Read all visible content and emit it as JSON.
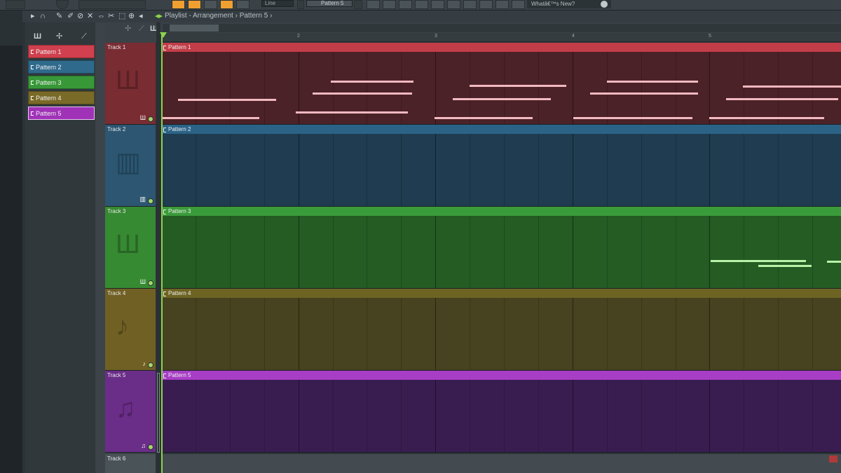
{
  "toolbar": {
    "snap_value": "Line",
    "pattern_selector": "Pattern 5",
    "whats_new": "Whatâ€™s New?"
  },
  "playlist": {
    "breadcrumb": "Playlist - Arrangement › Pattern 5 ›",
    "ruler": [
      "2",
      "3",
      "4",
      "5"
    ]
  },
  "picker": {
    "patterns": [
      {
        "label": "Pattern 1",
        "color": "#d0404e"
      },
      {
        "label": "Pattern 2",
        "color": "#2f6a8c"
      },
      {
        "label": "Pattern 3",
        "color": "#389838"
      },
      {
        "label": "Pattern 4",
        "color": "#7a6a28"
      },
      {
        "label": "Pattern 5",
        "color": "#a032b8"
      }
    ]
  },
  "tracks": [
    {
      "label": "Track 1",
      "clip": "Pattern 1",
      "header_color": "#7a2c33",
      "lane_color": "#4b2228",
      "clip_color": "#c33d48",
      "note_color": "#f3b9c0",
      "icon": "piano-roll-icon"
    },
    {
      "label": "Track 2",
      "clip": "Pattern 2",
      "header_color": "#2c5672",
      "lane_color": "#1f3c50",
      "clip_color": "#2b6387",
      "note_color": "#9cd0ef",
      "icon": "drum-icon"
    },
    {
      "label": "Track 3",
      "clip": "Pattern 3",
      "header_color": "#368a32",
      "lane_color": "#245c24",
      "clip_color": "#3a9b3a",
      "note_color": "#b9f3a8",
      "icon": "piano-roll-icon"
    },
    {
      "label": "Track 4",
      "clip": "Pattern 4",
      "header_color": "#706024",
      "lane_color": "#47421f",
      "clip_color": "#6d6424",
      "note_color": "#e3d48a",
      "icon": "guitar-icon"
    },
    {
      "label": "Track 5",
      "clip": "Pattern 5",
      "header_color": "#6a2d88",
      "lane_color": "#3a1d50",
      "clip_color": "#a83ec6",
      "note_color": "#e3a8f3",
      "icon": "violin-icon"
    },
    {
      "label": "Track 6"
    }
  ]
}
